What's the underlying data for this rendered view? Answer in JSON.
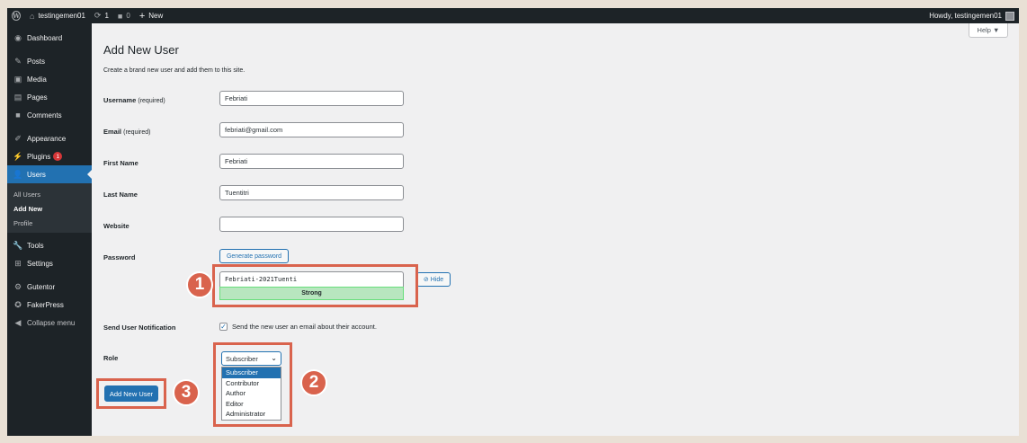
{
  "adminbar": {
    "site_name": "testingemen01",
    "updates_count": "1",
    "comments_count": "0",
    "new_label": "New",
    "howdy": "Howdy, testingemen01"
  },
  "help_label": "Help ▼",
  "sidebar": {
    "items": [
      {
        "label": "Dashboard",
        "icon": "dashboard-icon"
      },
      {
        "label": "Posts",
        "icon": "pin-icon"
      },
      {
        "label": "Media",
        "icon": "media-icon"
      },
      {
        "label": "Pages",
        "icon": "pages-icon"
      },
      {
        "label": "Comments",
        "icon": "comment-icon"
      },
      {
        "label": "Appearance",
        "icon": "brush-icon"
      },
      {
        "label": "Plugins",
        "icon": "plug-icon",
        "badge": "1"
      },
      {
        "label": "Users",
        "icon": "users-icon",
        "active": true
      },
      {
        "label": "Tools",
        "icon": "wrench-icon"
      },
      {
        "label": "Settings",
        "icon": "settings-icon"
      },
      {
        "label": "Gutentor",
        "icon": "gutentor-icon"
      },
      {
        "label": "FakerPress",
        "icon": "fakerpress-icon"
      },
      {
        "label": "Collapse menu",
        "icon": "collapse-icon"
      }
    ],
    "submenu": [
      "All Users",
      "Add New",
      "Profile"
    ],
    "current_submenu": "Add New"
  },
  "page": {
    "title": "Add New User",
    "intro": "Create a brand new user and add them to this site."
  },
  "form": {
    "username_label": "Username",
    "username_req": "(required)",
    "username_value": "Febriati",
    "email_label": "Email",
    "email_req": "(required)",
    "email_value": "febriati@gmail.com",
    "first_name_label": "First Name",
    "first_name_value": "Febriati",
    "last_name_label": "Last Name",
    "last_name_value": "Tuentitri",
    "website_label": "Website",
    "website_value": "",
    "password_label": "Password",
    "generate_password": "Generate password",
    "password_value": "Febriati-2021Tuenti",
    "password_strength": "Strong",
    "hide_label": "Hide",
    "notification_label": "Send User Notification",
    "notification_text": "Send the new user an email about their account.",
    "role_label": "Role",
    "role_selected": "Subscriber",
    "role_options": [
      "Subscriber",
      "Contributor",
      "Author",
      "Editor",
      "Administrator"
    ],
    "submit_label": "Add New User"
  },
  "annotations": {
    "step1": "1",
    "step2": "2",
    "step3": "3",
    "color": "#d9634d"
  }
}
